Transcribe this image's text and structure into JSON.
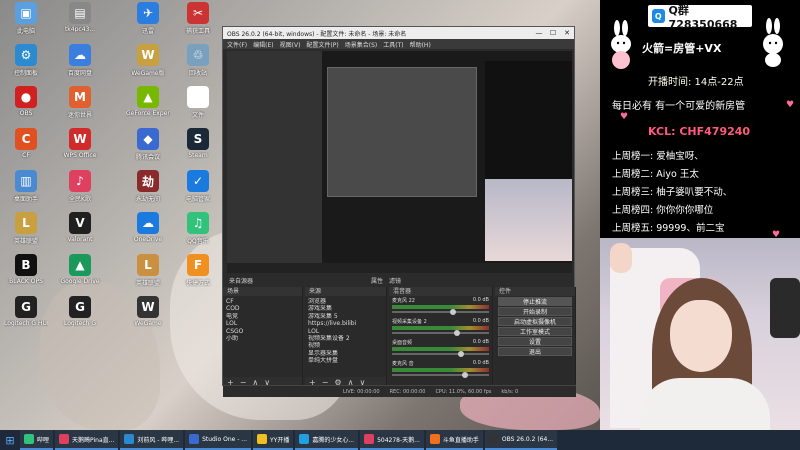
{
  "desktop": {
    "icons": [
      {
        "label": "此电脑",
        "glyph": "▣",
        "color": "#5aa0e0"
      },
      {
        "label": "tk4pc43...",
        "glyph": "▤",
        "color": "#888"
      },
      {
        "label": "迅雷",
        "glyph": "✈",
        "color": "#2b7de0"
      },
      {
        "label": "捕获工具",
        "glyph": "✂",
        "color": "#cc3333"
      },
      {
        "label": "控制面板",
        "glyph": "⚙",
        "color": "#2b8ad0"
      },
      {
        "label": "百度网盘",
        "glyph": "☁",
        "color": "#3a7ee0"
      },
      {
        "label": "WeGame版",
        "glyph": "W",
        "color": "#c8a040"
      },
      {
        "label": "回收站",
        "glyph": "♲",
        "color": "#7aa0c0"
      },
      {
        "label": "OBS",
        "glyph": "●",
        "color": "#d02020"
      },
      {
        "label": "迷你世界",
        "glyph": "M",
        "color": "#e06030"
      },
      {
        "label": "GeForce Experience",
        "glyph": "▲",
        "color": "#76b900"
      },
      {
        "label": "文件",
        "glyph": "▦",
        "color": "#ffffff"
      },
      {
        "label": "CF",
        "glyph": "C",
        "color": "#e05020"
      },
      {
        "label": "WPS Office",
        "glyph": "W",
        "color": "#d02a2a"
      },
      {
        "label": "腾讯会议",
        "glyph": "◆",
        "color": "#3a6ad0"
      },
      {
        "label": "Steam",
        "glyph": "S",
        "color": "#1b2838"
      },
      {
        "label": "桌面助手",
        "glyph": "▥",
        "color": "#4a8ad0"
      },
      {
        "label": "全民K歌",
        "glyph": "♪",
        "color": "#e04060"
      },
      {
        "label": "永劫无间",
        "glyph": "劫",
        "color": "#8a2a2a"
      },
      {
        "label": "电脑管家",
        "glyph": "✓",
        "color": "#1a7ae0"
      },
      {
        "label": "英雄联盟",
        "glyph": "L",
        "color": "#c8a040"
      },
      {
        "label": "Valorant",
        "glyph": "V",
        "color": "#202020"
      },
      {
        "label": "OneDrive",
        "glyph": "☁",
        "color": "#1a7ae0"
      },
      {
        "label": "QQ音乐",
        "glyph": "♫",
        "color": "#31c27c"
      },
      {
        "label": "BLACK OPS",
        "glyph": "B",
        "color": "#111111"
      },
      {
        "label": "Google Drive",
        "glyph": "▲",
        "color": "#1a9a5a"
      },
      {
        "label": "英雄联盟",
        "glyph": "L",
        "color": "#c89040"
      },
      {
        "label": "快捷方式",
        "glyph": "F",
        "color": "#f09020"
      },
      {
        "label": "Logitech G HUB",
        "glyph": "G",
        "color": "#222"
      },
      {
        "label": "Logitech G",
        "glyph": "G",
        "color": "#222"
      },
      {
        "label": "WeGame",
        "glyph": "W",
        "color": "#333"
      }
    ]
  },
  "obs": {
    "title": "OBS 26.0.2 (64-bit, windows) - 配置文件: 未命名 - 场景: 未命名",
    "menu": [
      "文件(F)",
      "编辑(E)",
      "视图(V)",
      "配置文件(P)",
      "场景集合(S)",
      "工具(T)",
      "帮助(H)"
    ],
    "subtitles": {
      "label": "来自源器",
      "items": [
        "属性",
        "滤镜"
      ]
    },
    "scenes": {
      "title": "场景",
      "items": [
        "CF",
        "COD",
        "电竞",
        "LOL",
        "CSGO",
        "小助"
      ]
    },
    "sources": {
      "title": "来源",
      "items": [
        "浏览器",
        "游戏采集",
        "游戏采集 5",
        "https://live.bilibi",
        "LOL",
        "视频采集设备 2",
        "视频",
        "显示器采集",
        "单纯大拼盘"
      ]
    },
    "mixer": {
      "title": "混音器",
      "tracks": [
        {
          "name": "麦克风 22",
          "db": "0.0 dB"
        },
        {
          "name": "视频采集设备 2",
          "db": "0.0 dB"
        },
        {
          "name": "桌面音频",
          "db": "0.0 dB"
        },
        {
          "name": "麦克风 音",
          "db": "0.0 dB"
        }
      ]
    },
    "controls": {
      "title": "控件",
      "buttons": [
        "停止推流",
        "开始录制",
        "启动虚拟摄像机",
        "工作室模式",
        "设置",
        "退出"
      ]
    },
    "status": {
      "live": "LIVE: 00:00:00",
      "rec": "REC: 00:00:00",
      "cpu": "CPU: 11.0%, 60.00 fps",
      "kbps": "kb/s: 0"
    }
  },
  "taskbar": {
    "items": [
      {
        "label": "哔哩",
        "color": "#31c27c"
      },
      {
        "label": "天鹅畸Pina直...",
        "color": "#e04060"
      },
      {
        "label": "刘前风 - 哔哩...",
        "color": "#2a8ad0"
      },
      {
        "label": "Studio One - ...",
        "color": "#3a6ad0"
      },
      {
        "label": "YY开播",
        "color": "#f0c020"
      },
      {
        "label": "嘉腾的少女心...",
        "color": "#20a0e0"
      },
      {
        "label": "504278-天鹅...",
        "color": "#e04060"
      },
      {
        "label": "斗鱼直播助手",
        "color": "#f07020"
      },
      {
        "label": "OBS 26.0.2 (64...",
        "color": "#333"
      }
    ]
  },
  "overlay": {
    "qq_group": "Q群 728350668",
    "title": "火箭=房管+VX",
    "hours": "开播时间: 14点-22点",
    "tagline": "每日必有 有一个可爱的新房管",
    "kcl": "KCL: CHF479240",
    "ranks": [
      "上周榜一: 爱柚宝呀、",
      "上周榜二: Aiyo 王太",
      "上周榜三: 柚子婆叭要不动、",
      "上周榜四: 你你你你哪位",
      "上周榜五: 99999、前二宝"
    ],
    "accent": "#ff5a7a"
  }
}
